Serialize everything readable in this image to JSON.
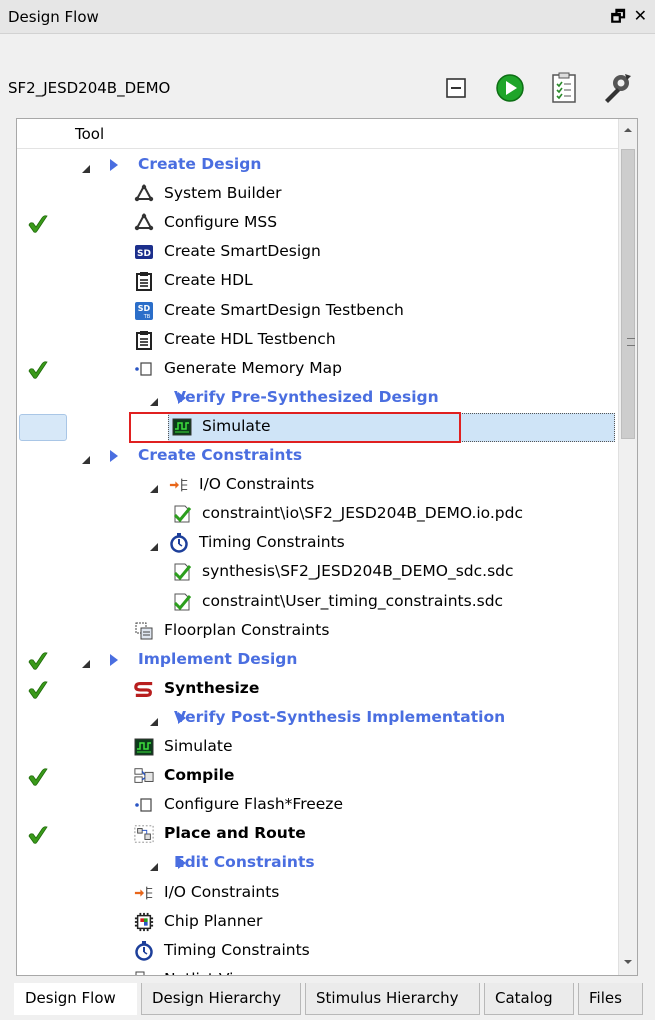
{
  "panel": {
    "title": "Design Flow",
    "float_glyph": "🗗",
    "close_glyph": "✕"
  },
  "project": {
    "name": "SF2_JESD204B_DEMO"
  },
  "toolbar": {
    "icons": [
      "collapse-all-icon",
      "run-icon",
      "report-icon",
      "options-wrench-icon"
    ]
  },
  "tree": {
    "header": "Tool",
    "rows": [
      {
        "label": "Create Design",
        "indent": 1,
        "expander": true,
        "marker": true,
        "kind": "section",
        "icon": "",
        "check": false
      },
      {
        "label": "System Builder",
        "indent": 3,
        "kind": "normal",
        "icon": "system-builder-icon",
        "check": false
      },
      {
        "label": "Configure MSS",
        "indent": 3,
        "kind": "normal",
        "icon": "system-builder-icon",
        "check": true
      },
      {
        "label": "Create SmartDesign",
        "indent": 3,
        "kind": "normal",
        "icon": "smartdesign-icon",
        "check": false
      },
      {
        "label": "Create HDL",
        "indent": 3,
        "kind": "normal",
        "icon": "clipboard-icon",
        "check": false
      },
      {
        "label": "Create SmartDesign Testbench",
        "indent": 3,
        "kind": "normal",
        "icon": "smartdesign-tb-icon",
        "check": false
      },
      {
        "label": "Create HDL Testbench",
        "indent": 3,
        "kind": "normal",
        "icon": "clipboard-icon",
        "check": false
      },
      {
        "label": "Generate Memory Map",
        "indent": 3,
        "kind": "normal",
        "icon": "memory-map-icon",
        "check": true
      },
      {
        "label": "Verify Pre-Synthesized Design",
        "indent": 2,
        "expander": true,
        "marker": true,
        "kind": "section",
        "icon": "",
        "check": false
      },
      {
        "label": "Simulate",
        "indent": 4,
        "kind": "normal",
        "icon": "simulate-icon",
        "check": false,
        "selected": true
      },
      {
        "label": "Create Constraints",
        "indent": 1,
        "expander": true,
        "marker": true,
        "kind": "section",
        "icon": "",
        "check": false
      },
      {
        "label": "I/O Constraints",
        "indent": 2,
        "expander": true,
        "kind": "normal",
        "icon": "io-constraints-icon",
        "check": false
      },
      {
        "label": "constraint\\io\\SF2_JESD204B_DEMO.io.pdc",
        "indent": 4,
        "kind": "normal",
        "icon": "file-check-icon",
        "check": false
      },
      {
        "label": "Timing Constraints",
        "indent": 2,
        "expander": true,
        "kind": "normal",
        "icon": "stopwatch-icon",
        "check": false
      },
      {
        "label": "synthesis\\SF2_JESD204B_DEMO_sdc.sdc",
        "indent": 4,
        "kind": "normal",
        "icon": "file-check-icon",
        "check": false
      },
      {
        "label": "constraint\\User_timing_constraints.sdc",
        "indent": 4,
        "kind": "normal",
        "icon": "file-check-icon",
        "check": false
      },
      {
        "label": "Floorplan Constraints",
        "indent": 3,
        "kind": "normal",
        "icon": "floorplan-icon",
        "check": false
      },
      {
        "label": "Implement Design",
        "indent": 1,
        "expander": true,
        "marker": true,
        "kind": "section",
        "icon": "",
        "check": true
      },
      {
        "label": "Synthesize",
        "indent": 3,
        "kind": "bold",
        "icon": "synthesize-icon",
        "check": true
      },
      {
        "label": "Verify Post-Synthesis Implementation",
        "indent": 2,
        "expander": true,
        "marker": true,
        "kind": "section",
        "icon": "",
        "check": false
      },
      {
        "label": "Simulate",
        "indent": 3,
        "kind": "normal",
        "icon": "simulate-icon",
        "check": false
      },
      {
        "label": "Compile",
        "indent": 3,
        "kind": "bold",
        "icon": "compile-icon",
        "check": true
      },
      {
        "label": "Configure Flash*Freeze",
        "indent": 3,
        "kind": "normal",
        "icon": "memory-map-icon",
        "check": false
      },
      {
        "label": "Place and Route",
        "indent": 3,
        "kind": "bold",
        "icon": "place-route-icon",
        "check": true
      },
      {
        "label": "Edit Constraints",
        "indent": 2,
        "expander": true,
        "marker": true,
        "kind": "section",
        "icon": "",
        "check": false
      },
      {
        "label": "I/O Constraints",
        "indent": 3,
        "kind": "normal",
        "icon": "io-constraints-icon",
        "check": false
      },
      {
        "label": "Chip Planner",
        "indent": 3,
        "kind": "normal",
        "icon": "chip-planner-icon",
        "check": false
      },
      {
        "label": "Timing Constraints",
        "indent": 3,
        "kind": "normal",
        "icon": "stopwatch-icon",
        "check": false
      },
      {
        "label": "Netlist Viewer",
        "indent": 3,
        "kind": "normal",
        "icon": "netlist-viewer-icon",
        "check": false
      }
    ]
  },
  "tabs": [
    {
      "label": "Design Flow",
      "active": true
    },
    {
      "label": "Design Hierarchy",
      "active": false
    },
    {
      "label": "Stimulus Hierarchy",
      "active": false
    },
    {
      "label": "Catalog",
      "active": false
    },
    {
      "label": "Files",
      "active": false
    }
  ],
  "colors": {
    "section": "#4a6ee0",
    "check": "#3a9a1a",
    "highlight": "#e02020",
    "selection": "#cfe4f7"
  }
}
